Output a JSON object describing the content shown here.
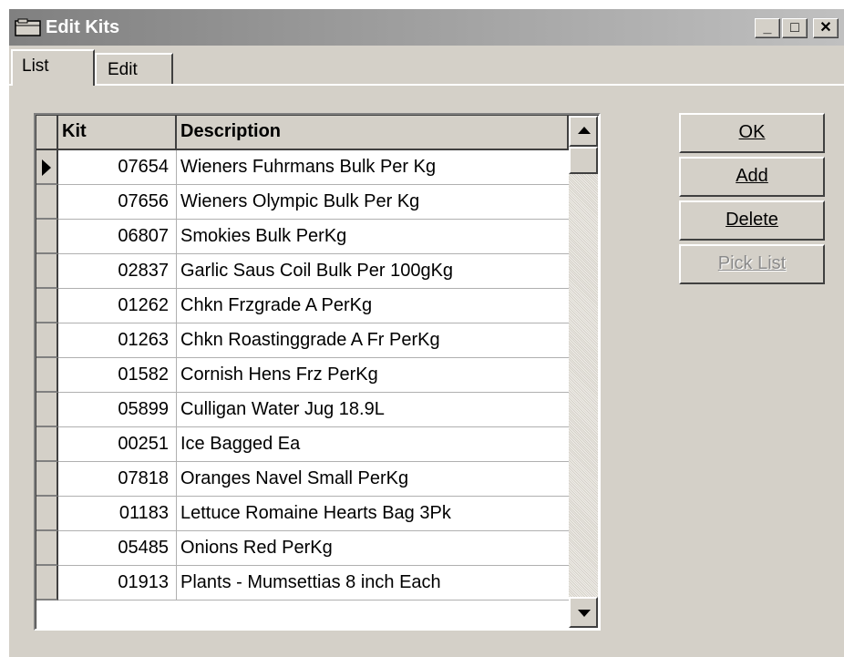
{
  "window": {
    "title": "Edit Kits",
    "controls": {
      "minimize": "_",
      "maximize": "□",
      "close": "✕"
    }
  },
  "tabs": [
    {
      "label": "List",
      "active": true
    },
    {
      "label": "Edit",
      "active": false
    }
  ],
  "grid": {
    "columns": [
      "Kit",
      "Description"
    ],
    "rows": [
      {
        "kit": "07654",
        "description": "Wieners Fuhrmans Bulk Per Kg",
        "current": true
      },
      {
        "kit": "07656",
        "description": "Wieners Olympic Bulk Per Kg"
      },
      {
        "kit": "06807",
        "description": "Smokies Bulk PerKg"
      },
      {
        "kit": "02837",
        "description": "Garlic Saus Coil Bulk Per 100gKg"
      },
      {
        "kit": "01262",
        "description": "Chkn Frzgrade A PerKg"
      },
      {
        "kit": "01263",
        "description": "Chkn Roastinggrade A Fr PerKg"
      },
      {
        "kit": "01582",
        "description": "Cornish Hens Frz PerKg"
      },
      {
        "kit": "05899",
        "description": "Culligan Water Jug 18.9L"
      },
      {
        "kit": "00251",
        "description": "Ice Bagged Ea"
      },
      {
        "kit": "07818",
        "description": "Oranges Navel Small PerKg"
      },
      {
        "kit": "01183",
        "description": "Lettuce Romaine Hearts Bag 3Pk"
      },
      {
        "kit": "05485",
        "description": "Onions Red PerKg"
      },
      {
        "kit": "01913",
        "description": "Plants - Mumsettias 8 inch Each"
      }
    ]
  },
  "buttons": {
    "ok": "OK",
    "add": "Add",
    "delete": "Delete",
    "pick_list": "Pick List"
  },
  "colors": {
    "face": "#d4d0c8",
    "title_gradient_start": "#808080",
    "title_gradient_end": "#c0c0c0",
    "disabled_text": "#8a8a8a"
  }
}
